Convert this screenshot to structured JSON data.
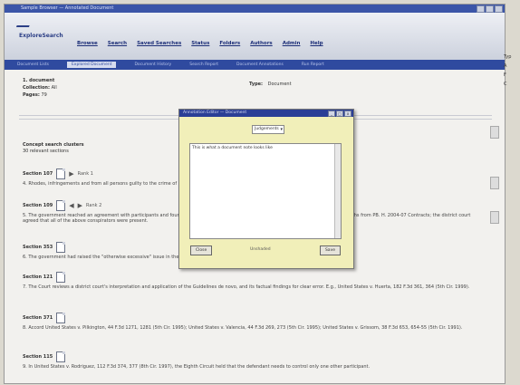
{
  "window": {
    "title": "Sample Browser — Annotated Document"
  },
  "header": {
    "logo": "ExploreSearch",
    "nav": [
      "Browse",
      "Search",
      "Saved Searches",
      "Status",
      "Folders",
      "Authors",
      "Admin",
      "Help"
    ]
  },
  "subnav": {
    "items": [
      "Document Lists",
      "Explored Document",
      "Document History",
      "Search Report",
      "Document Annotations",
      "Run Report"
    ],
    "active_index": 1
  },
  "doc": {
    "heading": "1. document",
    "collection_label": "Collection:",
    "collection_value": "All",
    "pages_label": "Pages:",
    "pages_value": "79",
    "type_label": "Type:",
    "type_value": "Document"
  },
  "concept": {
    "title": "Concept search clusters",
    "subtitle": "30 relevant sections"
  },
  "sections": [
    {
      "label": "Section 107",
      "rank": "Rank 1",
      "text": "4. Rhodes, infringements and from all persons guilty to the crime of conspiracy in the first degree on behalf of the government. 308 F.3d at 531."
    },
    {
      "label": "Section 109",
      "rank": "Rank 2",
      "text": "5. The government reached an agreement with participants and found that the conspiracy with fraud was established and continued from 5 months from PB. H. 2004-07 Contracts; the district court agreed that all of the above conspirators were present."
    },
    {
      "label": "Section 353",
      "rank": "",
      "text": "6. The government had raised the \"otherwise excessive\" issue in the trial court proceedings. (Sec. 38-2111T)"
    },
    {
      "label": "Section 121",
      "rank": "",
      "text": "7. The Court reviews a district court's interpretation and application of the Guidelines de novo, and its factual findings for clear error. E.g., United States v. Huerta, 182 F.3d 361, 364 (5th Cir. 1999)."
    },
    {
      "label": "Section 371",
      "rank": "",
      "text": "8. Accord United States v. Pilkington, 44 F.3d 1271, 1281 (5th Cir. 1995); United States v. Valencia, 44 F.3d 269, 273 (5th Cir. 1995); United States v. Grissom, 38 F.3d 653, 654-55 (5th Cir. 1991)."
    },
    {
      "label": "Section 115",
      "rank": "",
      "text": "9. In United States v. Rodriguez, 112 F.3d 374, 377 (8th Cir. 1997), the Eighth Circuit held that the defendant needs to control only one other participant."
    }
  ],
  "sidepanel": {
    "items": [
      "Typ",
      "A",
      "F",
      "C"
    ]
  },
  "dialog": {
    "title": "Annotation Editor — Document",
    "select_value": "Judgements",
    "text": "This is what a document note looks like",
    "close_label": "Close",
    "save_label": "Save",
    "status": "Unshaded"
  }
}
